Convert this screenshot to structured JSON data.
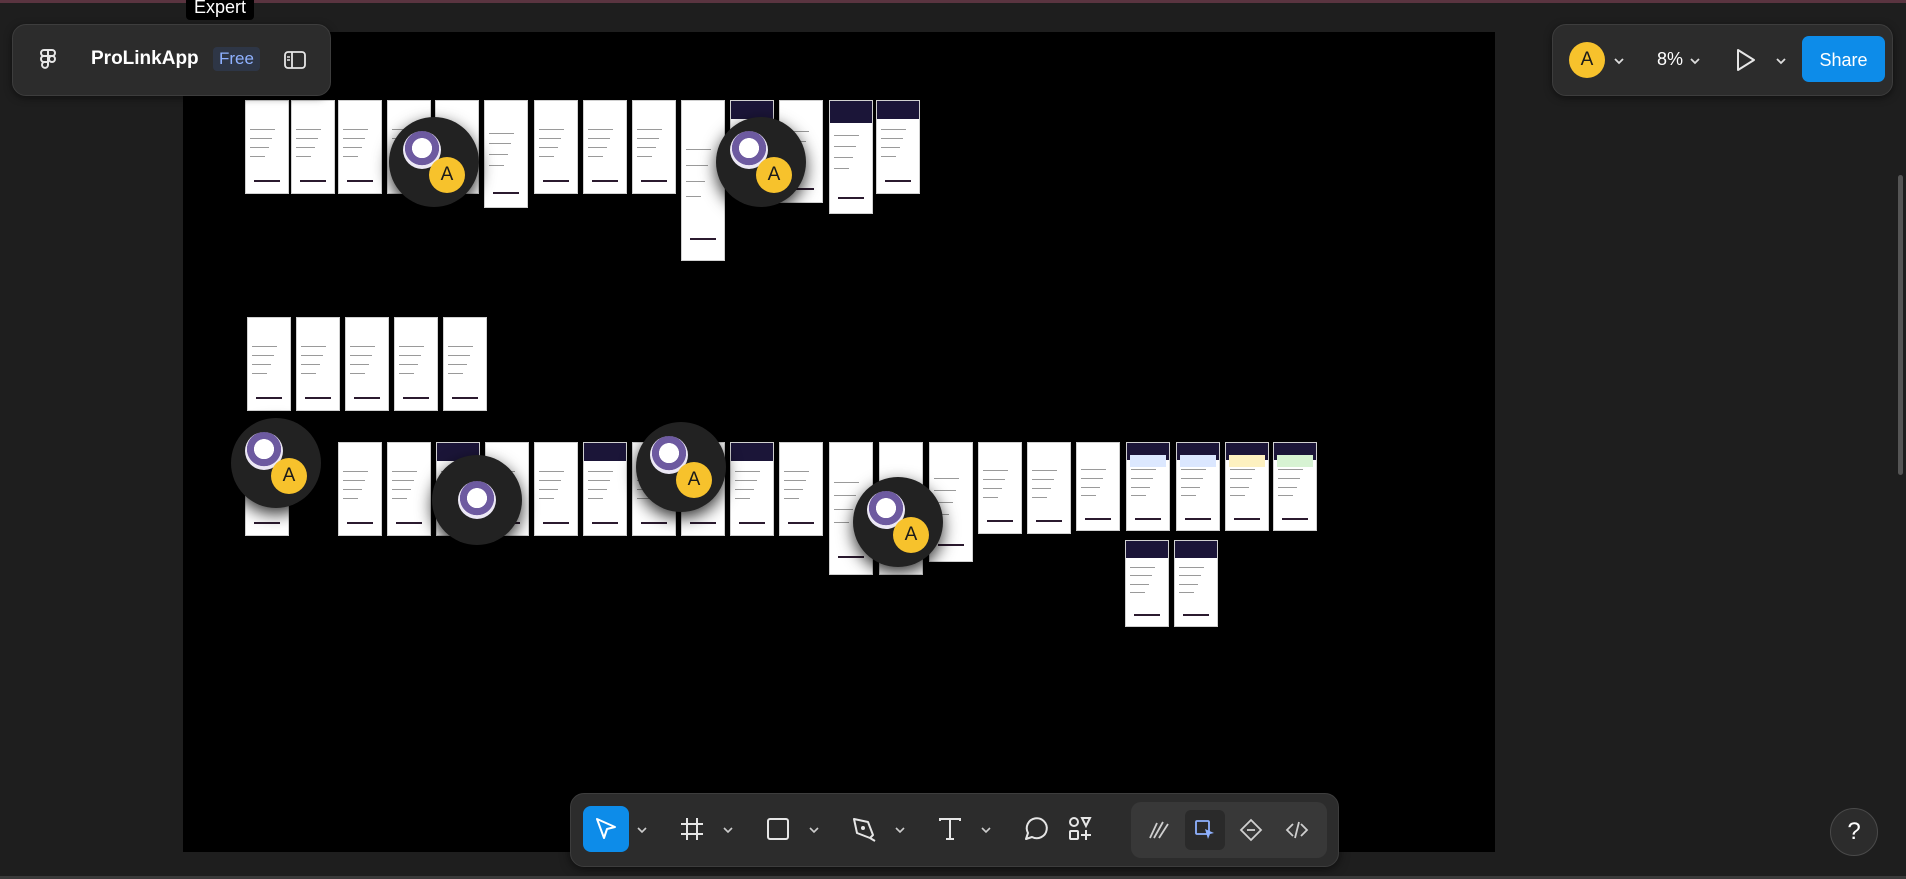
{
  "tooltip": "Expert",
  "file": {
    "name": "ProLinkApp",
    "plan_badge": "Free"
  },
  "header_right": {
    "user_initial": "A",
    "zoom": "8%",
    "share_label": "Share"
  },
  "collaborators": [
    {
      "initial": "A"
    },
    {
      "initial": "A"
    },
    {
      "initial": "A"
    },
    {
      "initial": "A"
    },
    {
      "initial": "A"
    },
    {
      "initial": ""
    }
  ],
  "toolbar": {
    "tools": [
      "move-tool",
      "frame-tool",
      "rectangle-tool",
      "pen-tool",
      "text-tool",
      "comment-tool",
      "actions-tool"
    ],
    "mode_tools": [
      "draw-mode",
      "design-mode",
      "prototype-mode",
      "dev-mode"
    ]
  },
  "help_label": "?",
  "colors": {
    "accent": "#0d8ce9",
    "avatar": "#f7c22c",
    "canvas": "#000000",
    "ui_background": "#1e1e1e",
    "panel": "#2c2c2c"
  }
}
